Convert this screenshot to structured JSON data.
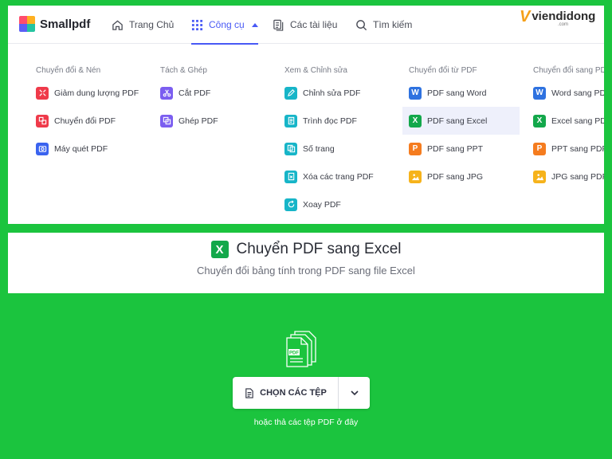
{
  "nav": {
    "brand": "Smallpdf",
    "items": [
      {
        "label": "Trang Chủ",
        "icon": "home-icon"
      },
      {
        "label": "Công cụ",
        "icon": "grid-icon"
      },
      {
        "label": "Các tài liệu",
        "icon": "documents-icon"
      },
      {
        "label": "Tìm kiếm",
        "icon": "search-icon"
      }
    ],
    "active_color": "#4859f5"
  },
  "watermark": {
    "text": "viendidong",
    "sub": ".com"
  },
  "menu": {
    "columns": [
      {
        "heading": "Chuyển đổi & Nén",
        "items": [
          {
            "label": "Giảm dung lượng PDF",
            "icon": "compress-icon",
            "color": "#ef3a4a"
          },
          {
            "label": "Chuyển đổi PDF",
            "icon": "convert-icon",
            "color": "#ef3a4a"
          },
          {
            "label": "Máy quét PDF",
            "icon": "scanner-icon",
            "color": "#3a63ef"
          }
        ]
      },
      {
        "heading": "Tách & Ghép",
        "items": [
          {
            "label": "Cắt PDF",
            "icon": "scissors-icon",
            "color": "#7b5ef0"
          },
          {
            "label": "Ghép PDF",
            "icon": "merge-icon",
            "color": "#7b5ef0"
          }
        ]
      },
      {
        "heading": "Xem & Chỉnh sửa",
        "items": [
          {
            "label": "Chỉnh sửa PDF",
            "icon": "edit-icon",
            "color": "#17b5c8"
          },
          {
            "label": "Trình đọc PDF",
            "icon": "reader-icon",
            "color": "#17b5c8"
          },
          {
            "label": "Số trang",
            "icon": "page-number-icon",
            "color": "#17b5c8"
          },
          {
            "label": "Xóa các trang PDF",
            "icon": "delete-pages-icon",
            "color": "#17b5c8"
          },
          {
            "label": "Xoay PDF",
            "icon": "rotate-icon",
            "color": "#17b5c8"
          }
        ]
      },
      {
        "heading": "Chuyển đổi từ PDF",
        "items": [
          {
            "label": "PDF sang Word",
            "icon": "word-icon",
            "glyph": "W",
            "color": "#2e72e0"
          },
          {
            "label": "PDF sang Excel",
            "icon": "excel-icon",
            "glyph": "X",
            "color": "#13a84b",
            "highlighted": true
          },
          {
            "label": "PDF sang PPT",
            "icon": "ppt-icon",
            "glyph": "P",
            "color": "#f57c1f"
          },
          {
            "label": "PDF sang JPG",
            "icon": "jpg-icon",
            "color": "#f6b31b"
          }
        ]
      },
      {
        "heading": "Chuyển đổi sang PDF",
        "items": [
          {
            "label": "Word sang PDF",
            "icon": "word-icon",
            "glyph": "W",
            "color": "#2e72e0"
          },
          {
            "label": "Excel sang PDF",
            "icon": "excel-icon",
            "glyph": "X",
            "color": "#13a84b"
          },
          {
            "label": "PPT sang PDF",
            "icon": "ppt-icon",
            "glyph": "P",
            "color": "#f57c1f"
          },
          {
            "label": "JPG sang PDF",
            "icon": "jpg-icon",
            "color": "#f6b31b"
          }
        ]
      }
    ]
  },
  "tool_page": {
    "title": "Chuyển PDF sang Excel",
    "badge": "X",
    "subtitle": "Chuyển đổi bảng tính trong PDF sang file Excel",
    "file_icon_label": "PDF",
    "choose_button": "CHỌN CÁC TỆP",
    "drop_hint": "hoặc thả các tệp PDF ở đây",
    "background_color": "#1bc43e"
  }
}
